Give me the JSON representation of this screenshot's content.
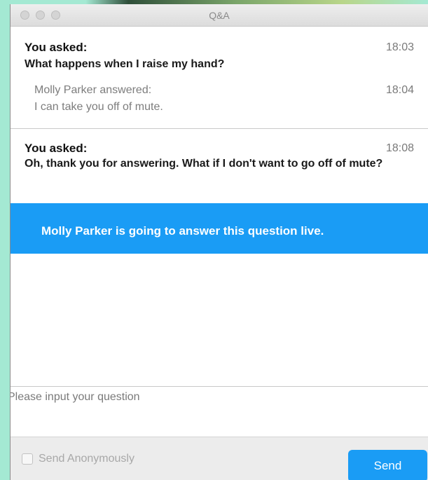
{
  "window": {
    "title": "Q&A"
  },
  "questions": [
    {
      "asker": "You asked:",
      "time": "18:03",
      "text": "What happens when I raise my hand?",
      "answer": {
        "header": "Molly Parker answered:",
        "time": "18:04",
        "text": "I can take you off of mute."
      }
    },
    {
      "asker": "You asked:",
      "time": "18:08",
      "text": "Oh, thank you for answering. What if I don't want to go off of mute?",
      "live_notice": "Molly Parker is going to answer this question live."
    }
  ],
  "input": {
    "placeholder": "Please input your question"
  },
  "footer": {
    "anonymous_label": "Send Anonymously",
    "send_label": "Send"
  },
  "colors": {
    "accent": "#1a9cf5",
    "background": "#a4e9d3"
  }
}
